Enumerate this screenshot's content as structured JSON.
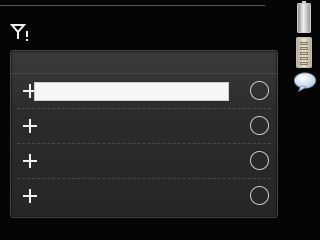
{
  "status_bar": {
    "signal_icon": "signal-warning-icon",
    "battery_icon": "battery-icon",
    "keyboard_icon": "keyboard-icon",
    "chat_icon": "chat-bubble-icon"
  },
  "list": {
    "rows": [
      {
        "add_icon": "plus-icon",
        "value": "",
        "has_field": true,
        "selected": false
      },
      {
        "add_icon": "plus-icon",
        "value": "",
        "has_field": false,
        "selected": false
      },
      {
        "add_icon": "plus-icon",
        "value": "",
        "has_field": false,
        "selected": false
      },
      {
        "add_icon": "plus-icon",
        "value": "",
        "has_field": false,
        "selected": false
      }
    ]
  },
  "colors": {
    "background": "#050505",
    "panel": "#2b2b2b",
    "field": "#f7f7f7",
    "icon": "#f2f2f2"
  }
}
